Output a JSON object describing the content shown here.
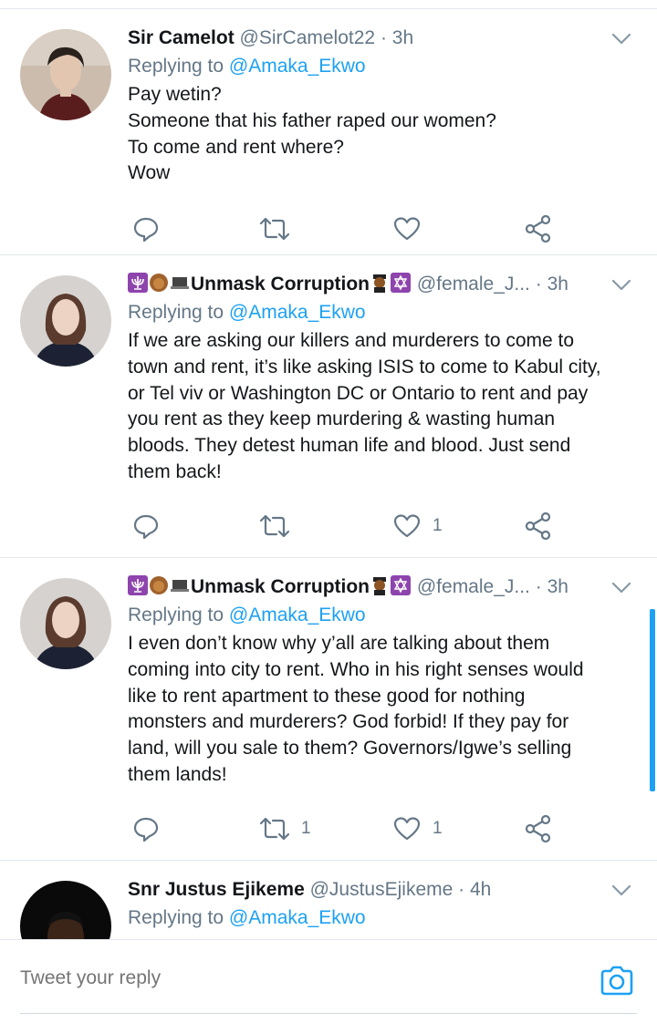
{
  "colors": {
    "accent": "#1da1f2",
    "secondary_text": "#657786",
    "divider": "#e1e8ed"
  },
  "tweets": [
    {
      "name": "Sir Camelot",
      "handle": "@SirCamelot22",
      "time": "3h",
      "replying_label": "Replying to",
      "replying_to": "@Amaka_Ekwo",
      "lines": [
        "Pay wetin?",
        "Someone that his father raped our women?",
        "To come and rent where?",
        "Wow"
      ],
      "retweets": "",
      "likes": ""
    },
    {
      "name": "Unmask Corruption",
      "handle": "@female_J...",
      "time": "3h",
      "replying_label": "Replying to",
      "replying_to": "@Amaka_Ekwo",
      "lines": [
        "If we are asking our killers and murderers to come to",
        "town and rent, it’s like asking ISIS to come to Kabul city,",
        "or Tel viv or Washington DC or Ontario to rent and pay",
        "you rent as they keep murdering & wasting human",
        "bloods. They detest human life and blood. Just send",
        "them back!"
      ],
      "retweets": "",
      "likes": "1"
    },
    {
      "name": "Unmask Corruption",
      "handle": "@female_J...",
      "time": "3h",
      "replying_label": "Replying to",
      "replying_to": "@Amaka_Ekwo",
      "lines": [
        "I even don’t know why y’all are talking about them",
        "coming into city to rent. Who in his right senses would",
        "like to rent apartment to these good for nothing",
        "monsters and murderers? God forbid! If they pay for",
        "land, will you sale to them? Governors/Igwe’s selling",
        "them lands!"
      ],
      "retweets": "1",
      "likes": "1"
    },
    {
      "name": "Snr Justus Ejikeme",
      "handle": "@JustusEjikeme",
      "time": "4h",
      "replying_label": "Replying to",
      "replying_to": "@Amaka_Ekwo"
    }
  ],
  "composer": {
    "placeholder": "Tweet your reply"
  },
  "separator": "·"
}
